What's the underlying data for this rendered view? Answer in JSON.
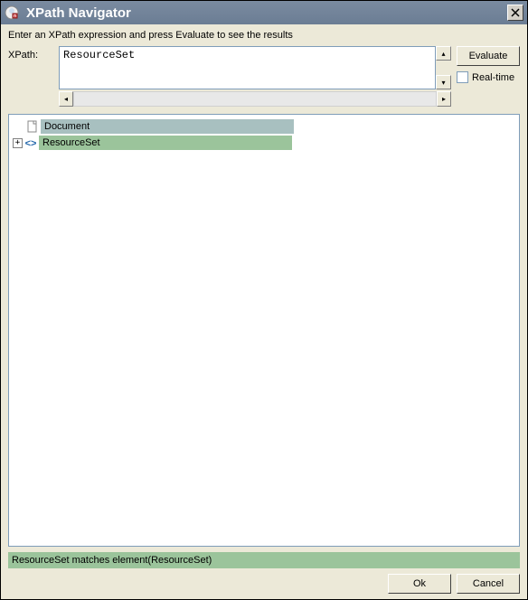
{
  "window": {
    "title": "XPath Navigator"
  },
  "instruction": "Enter an XPath expression and press Evaluate to see the results",
  "xpath": {
    "label": "XPath:",
    "value": "ResourceSet"
  },
  "buttons": {
    "evaluate": "Evaluate",
    "realtime": "Real-time",
    "ok": "Ok",
    "cancel": "Cancel"
  },
  "tree": {
    "document": "Document",
    "nodes": [
      {
        "name": "ResourceSet",
        "matched": true,
        "expandable": true
      }
    ]
  },
  "status": "ResourceSet matches element(ResourceSet)"
}
